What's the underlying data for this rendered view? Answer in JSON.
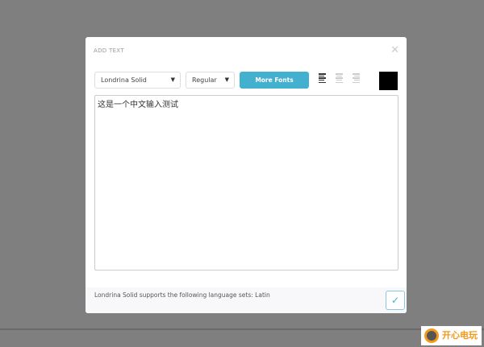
{
  "dialog": {
    "title": "ADD TEXT",
    "close_icon": "close-icon"
  },
  "toolbar": {
    "font": "Londrina Solid",
    "style": "Regular",
    "more_fonts": "More Fonts",
    "color": "#000000",
    "accent": "#44b0d0"
  },
  "editor": {
    "value": "这是一个中文输入测试"
  },
  "footer": {
    "info": "Londrina Solid supports the following language sets: Latin"
  },
  "watermark": {
    "text": "开心电玩",
    "url": "www.kxdw.com"
  }
}
